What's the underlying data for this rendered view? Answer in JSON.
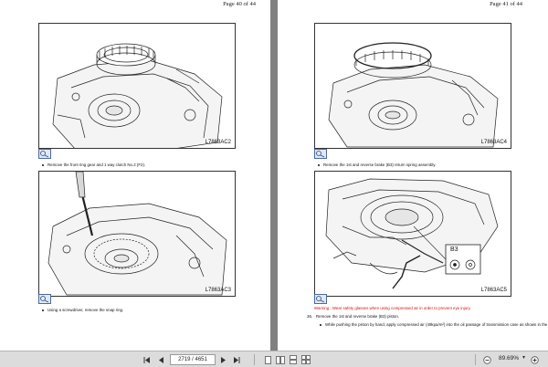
{
  "pages": [
    {
      "page_label": "Page 40 of 44",
      "figures": [
        {
          "id": "L7863AC2",
          "caption": "Remove the front ring gear and 1 way clutch No.2 (F2)."
        },
        {
          "id": "L7863AC3",
          "caption": "Using a screwdriver, remove the snap ring."
        }
      ]
    },
    {
      "page_label": "Page 41 of 44",
      "figures": [
        {
          "id": "L7863AC4",
          "caption": "Remove the 1st and reverse brake (B3) return spring assembly."
        },
        {
          "id": "L7863AC5",
          "callout_label": "B3"
        }
      ],
      "warning": "Warning : Wear safety glasses when using compressed air in order to prevent eye injury.",
      "step_number": "36.",
      "step_text": "Remove the 1st and reverse brake (B3) piston.",
      "step_bullet": "While pushing the piston by hand, apply compressed air (49kpa/m²) into the oil passage of transmission case as shown in the"
    }
  ],
  "toolbar": {
    "first_icon": "first-page-icon",
    "prev_icon": "previous-page-icon",
    "page_value": "2719 / 4651",
    "next_icon": "next-page-icon",
    "last_icon": "last-page-icon",
    "zoom_label": "89.69%",
    "zoom_dropdown": "▾"
  },
  "colors": {
    "warning": "#d21010",
    "toolbar_bg": "#dcdcdc",
    "viewer_bg": "#808080"
  }
}
